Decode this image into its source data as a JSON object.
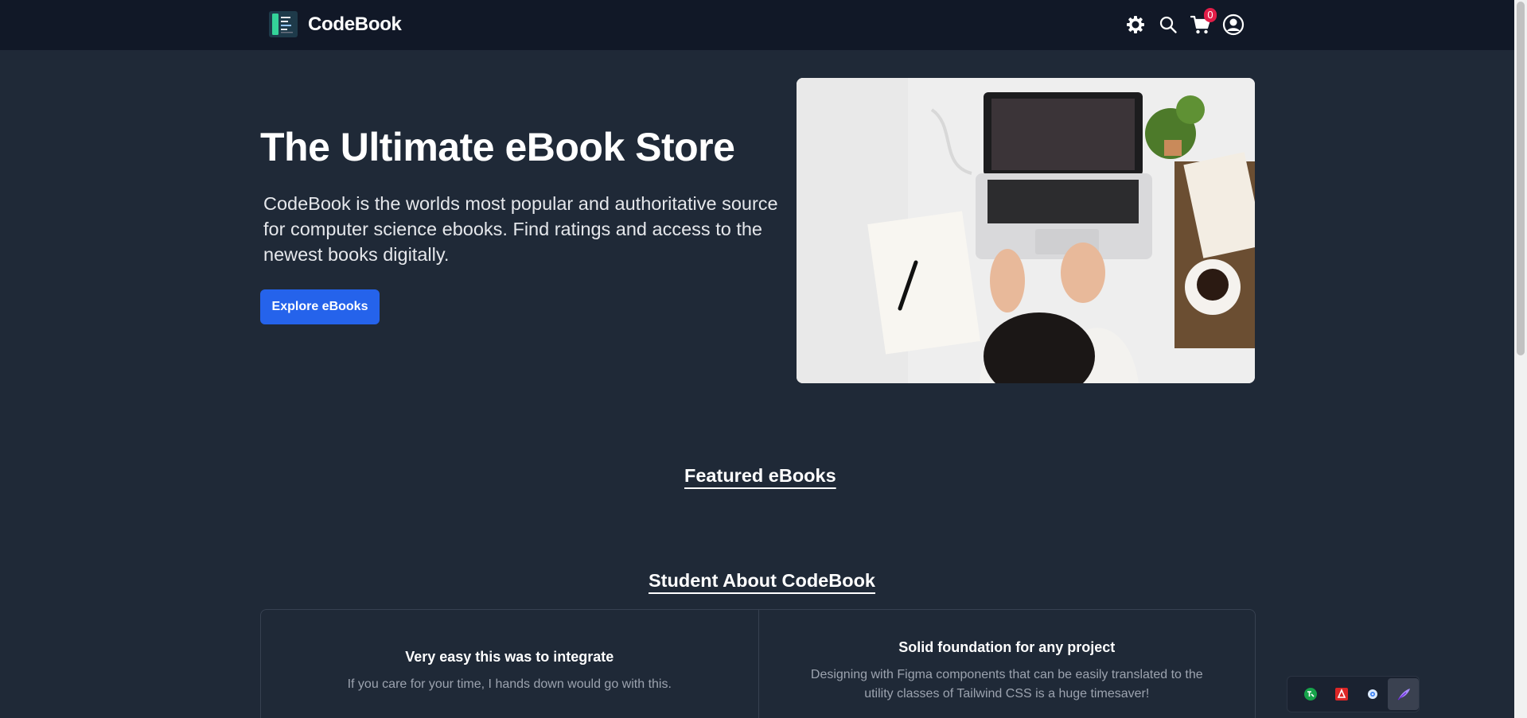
{
  "navbar": {
    "brand": "CodeBook",
    "cart_count": "0"
  },
  "hero": {
    "title": "The Ultimate eBook Store",
    "description": "CodeBook is the worlds most popular and authoritative source for computer science ebooks. Find ratings and access to the newest books digitally.",
    "cta": "Explore eBooks"
  },
  "featured": {
    "title": "Featured eBooks"
  },
  "testimonials": {
    "title": "Student About CodeBook",
    "items": [
      {
        "title": "Very easy this was to integrate",
        "body": "If you care for your time, I hands down would go with this."
      },
      {
        "title": "Solid foundation for any project",
        "body": "Designing with Figma components that can be easily translated to the utility classes of Tailwind CSS is a huge timesaver!"
      }
    ]
  },
  "icons": {
    "settings": "gear-icon",
    "search": "search-icon",
    "cart": "cart-icon",
    "account": "user-circle-icon"
  },
  "colors": {
    "page_bg": "#1f2937",
    "navbar_bg": "#111827",
    "accent": "#2563eb",
    "badge": "#e11d48"
  }
}
